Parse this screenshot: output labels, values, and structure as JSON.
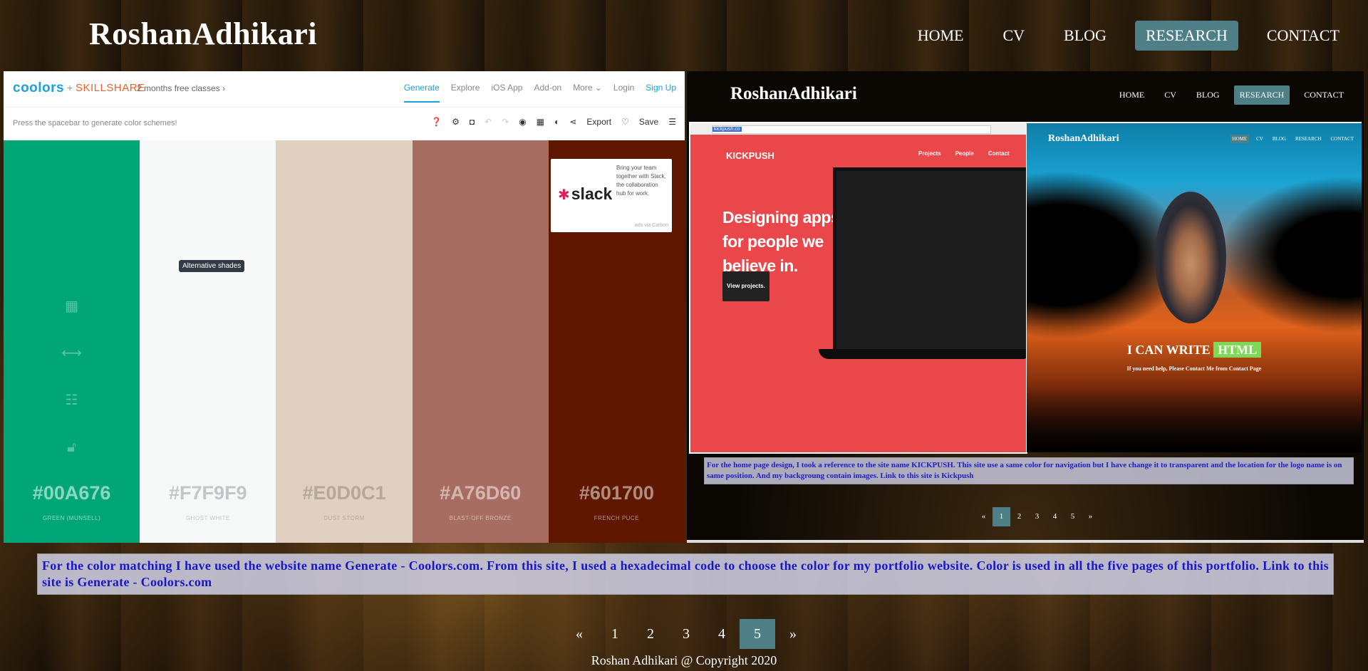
{
  "header": {
    "logo": "RoshanAdhikari",
    "nav": [
      "HOME",
      "CV",
      "BLOG",
      "RESEARCH",
      "CONTACT"
    ],
    "active_nav": "RESEARCH",
    "accent_color": "#4f7f86"
  },
  "left_shot": {
    "coolors_logo": "coolors",
    "plus": "+",
    "skillshare": "SKILLSHARE",
    "promo": "2 months free classes ›",
    "nav": [
      "Generate",
      "Explore",
      "iOS App",
      "Add-on",
      "More ⌄",
      "Login",
      "Sign Up"
    ],
    "hint": "Press the spacebar to generate color schemes!",
    "export_label": "Export",
    "save_label": "Save",
    "tooltip": "Alternative shades",
    "swatches": [
      {
        "hex": "#00A676",
        "name": "GREEN (MUNSELL)",
        "color": "#00A676",
        "text": "rgba(255,255,255,.55)"
      },
      {
        "hex": "#F7F9F9",
        "name": "GHOST WHITE",
        "color": "#F7F9F9",
        "text": "#c3c6c8"
      },
      {
        "hex": "#E0D0C1",
        "name": "DUST STORM",
        "color": "#E0D0C1",
        "text": "#b6a898"
      },
      {
        "hex": "#A76D60",
        "name": "BLAST-OFF BRONZE",
        "color": "#A76D60",
        "text": "rgba(255,255,255,.5)"
      },
      {
        "hex": "#601700",
        "name": "FRENCH PUCE",
        "color": "#601700",
        "text": "rgba(255,255,255,.5)"
      }
    ],
    "ad": {
      "brand": "slack",
      "copy": "Bring your team together with Slack, the collaboration hub for work.",
      "via": "ads via Carbon"
    }
  },
  "right_shot": {
    "logo": "RoshanAdhikari",
    "nav": [
      "HOME",
      "CV",
      "BLOG",
      "RESEARCH",
      "CONTACT"
    ],
    "kickpush": {
      "url": "kickpush.co",
      "brand": "KICKPUSH",
      "nav": [
        "Projects",
        "People",
        "Contact"
      ],
      "headline": "Designing apps for people we believe in.",
      "button": "View projects."
    },
    "portfolio": {
      "logo": "RoshanAdhikari",
      "nav": [
        "HOME",
        "CV",
        "BLOG",
        "RESEARCH",
        "CONTACT"
      ],
      "tagline_prefix": "I CAN WRITE",
      "tagline_highlight": "HTML",
      "sub": "If you need help, Please Contact Me from Contact Page"
    },
    "caption": "For the home page design, I took a reference to the site name KICKPUSH. This site use a same color for navigation but I have change it to transparent and the location for the logo name is on same position. And my backgroung contain images. Link to this site is Kickpush",
    "pagination": [
      "«",
      "1",
      "2",
      "3",
      "4",
      "5",
      "»"
    ],
    "active_page": "1"
  },
  "caption": "For the color matching I have used the website name Generate - Coolors.com. From this site, I used a hexadecimal code to choose the color for my portfolio website. Color is used in all the five pages of this portfolio. Link to this site is Generate - Coolors.com",
  "pagination": [
    "«",
    "1",
    "2",
    "3",
    "4",
    "5",
    "»"
  ],
  "active_page": "5",
  "footer": "Roshan Adhikari @ Copyright 2020"
}
